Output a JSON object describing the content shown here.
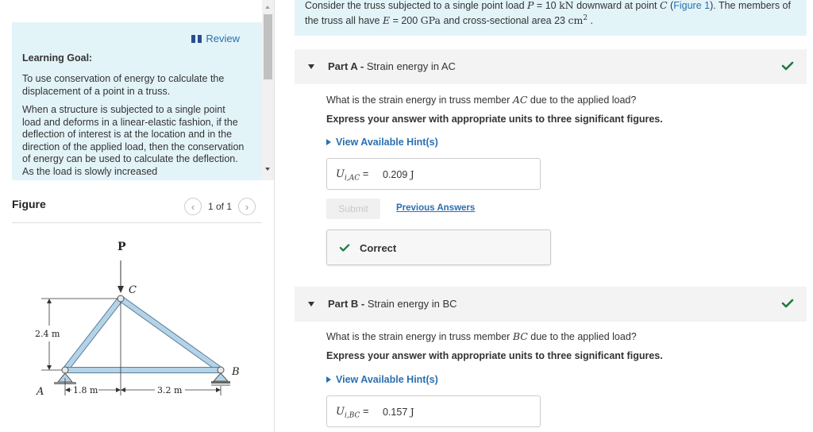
{
  "left": {
    "review_label": "Review",
    "goal_title": "Learning Goal:",
    "goal_paragraphs": [
      "To use conservation of energy to calculate the displacement of a point in a truss.",
      "When a structure is subjected to a single point load and deforms in a linear-elastic fashion, if the deflection of interest is at the location and in the direction of the applied load, then the conservation of energy can be used to calculate the deflection. As the load is slowly increased"
    ],
    "figure_title": "Figure",
    "pager_text": "1 of 1",
    "truss_labels": {
      "load": "P",
      "node_c": "C",
      "node_a": "A",
      "node_b": "B",
      "height": "2.4 m",
      "dim_left": "1.8 m",
      "dim_right": "3.2 m"
    }
  },
  "problem": {
    "prefix": "Consider the truss subjected to a single point load ",
    "load_symbol": "P",
    "load_eq": " = 10 ",
    "load_unit": "kN",
    "mid": " downward at point ",
    "point": "C",
    "open_paren": " (",
    "figure_link": "Figure 1",
    "after_link": "). The members of the truss all have ",
    "modulus_symbol": "E",
    "modulus_eq": " = 200 ",
    "modulus_unit": "GPa",
    "area_text": " and cross-sectional area 23 ",
    "area_unit": "cm",
    "area_exp": "2",
    "end": " ."
  },
  "part_a": {
    "label": "Part A - ",
    "title": "Strain energy in AC",
    "question_prefix": "What is the strain energy in truss member ",
    "member": "AC",
    "question_suffix": " due to the applied load?",
    "instruction": "Express your answer with appropriate units to three significant figures.",
    "hint_label": "View Available Hint(s)",
    "answer_var": "U",
    "answer_sub": "i,AC",
    "answer_eq": " = ",
    "answer_value": "0.209",
    "answer_unit": "J",
    "submit_label": "Submit",
    "previous_label": "Previous Answers",
    "correct_label": "Correct"
  },
  "part_b": {
    "label": "Part B - ",
    "title": "Strain energy in BC",
    "question_prefix": "What is the strain energy in truss member ",
    "member": "BC",
    "question_suffix": " due to the applied load?",
    "instruction": "Express your answer with appropriate units to three significant figures.",
    "hint_label": "View Available Hint(s)",
    "answer_var": "U",
    "answer_sub": "i,BC",
    "answer_eq": " = ",
    "answer_value": "0.157",
    "answer_unit": "J"
  },
  "colors": {
    "accent": "#2a6fb0",
    "goal_bg": "#e3f4f9",
    "check": "#1e7a3c",
    "truss_member": "#b5d3e8"
  }
}
